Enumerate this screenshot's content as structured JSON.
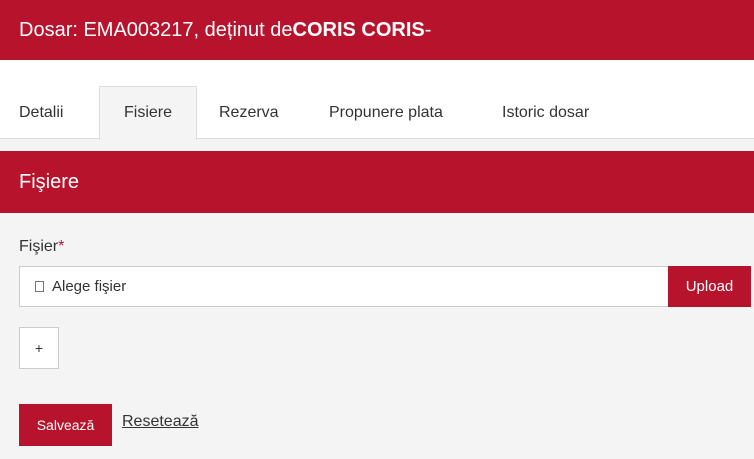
{
  "header": {
    "prefix": "Dosar: EMA003217, deținut de ",
    "owner": "CORIS CORIS",
    "suffix": " -"
  },
  "tabs": [
    {
      "label": "Detalii",
      "active": false
    },
    {
      "label": "Fisiere",
      "active": true
    },
    {
      "label": "Rezerva",
      "active": false
    },
    {
      "label": "Propunere plata",
      "active": false
    },
    {
      "label": "Istoric dosar",
      "active": false
    }
  ],
  "section": {
    "title": "Fişiere"
  },
  "form": {
    "file_label": "Fişier",
    "required_mark": "*",
    "file_placeholder": "Alege fişier",
    "upload_label": "Upload",
    "add_label": "+",
    "save_label": "Salvează",
    "reset_label": "Resetează"
  },
  "colors": {
    "accent": "#b8132d",
    "background": "#f4f4f4"
  }
}
